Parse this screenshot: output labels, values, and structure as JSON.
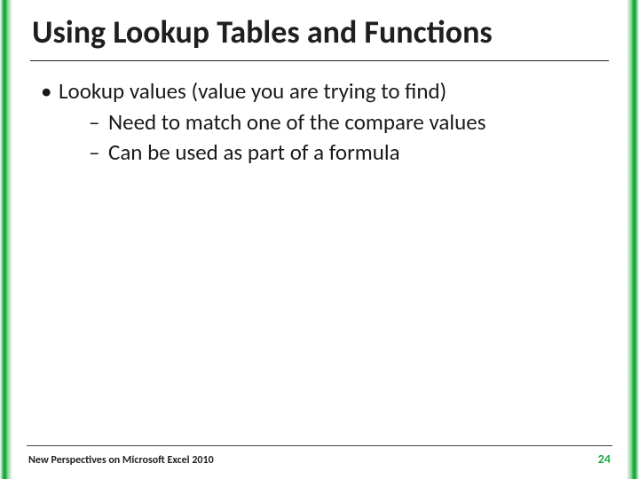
{
  "title": "Using Lookup Tables and Functions",
  "bullets": {
    "lvl1": "Lookup values (value you are trying to find)",
    "lvl2a": "Need to match one of the compare values",
    "lvl2b": "Can be used as part of a formula"
  },
  "footer": {
    "text": "New Perspectives on Microsoft Excel 2010",
    "page": "24"
  },
  "marks": {
    "bullet": "•",
    "dash": "–"
  }
}
